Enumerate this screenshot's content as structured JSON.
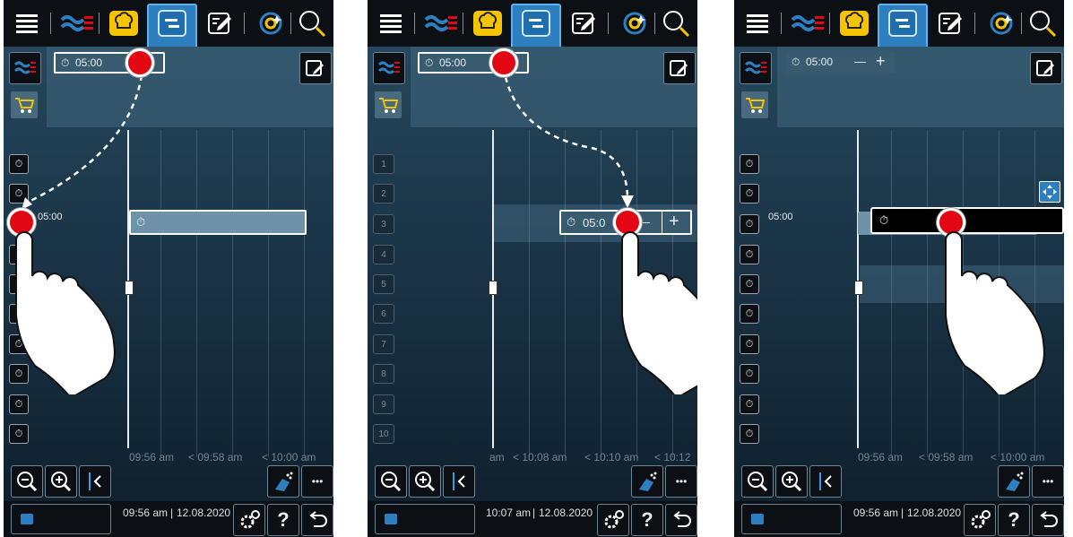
{
  "panels": [
    {
      "time": "09:56 am",
      "date": "12.08.2020",
      "ticks": [
        "09:56 am",
        "< 09:58 am",
        "< 10:00 am"
      ],
      "timer_value": "05:00",
      "slot_label": "05:00"
    },
    {
      "time": "10:07 am",
      "date": "12.08.2020",
      "ticks": [
        "am",
        "< 10:08 am",
        "< 10:10 am",
        "< 10:12"
      ],
      "timer_value": "05:00",
      "slot_label": "05:0",
      "numbers": [
        "1",
        "2",
        "3",
        "4",
        "5",
        "6",
        "7",
        "8",
        "9",
        "10"
      ]
    },
    {
      "time": "09:56 am",
      "date": "12.08.2020",
      "ticks": [
        "09:56 am",
        "< 09:58 am",
        "< 10:00 am"
      ],
      "timer_value": "05:00",
      "slot_label": "05:00"
    }
  ],
  "timer_suffix": "\"",
  "minus": "—",
  "plus": "+",
  "help": "?",
  "dots": "•••",
  "clock_icon": "⏱",
  "colors": {
    "accent": "#2e7fbf",
    "tap": "#e30613",
    "yellow": "#f5c400"
  }
}
